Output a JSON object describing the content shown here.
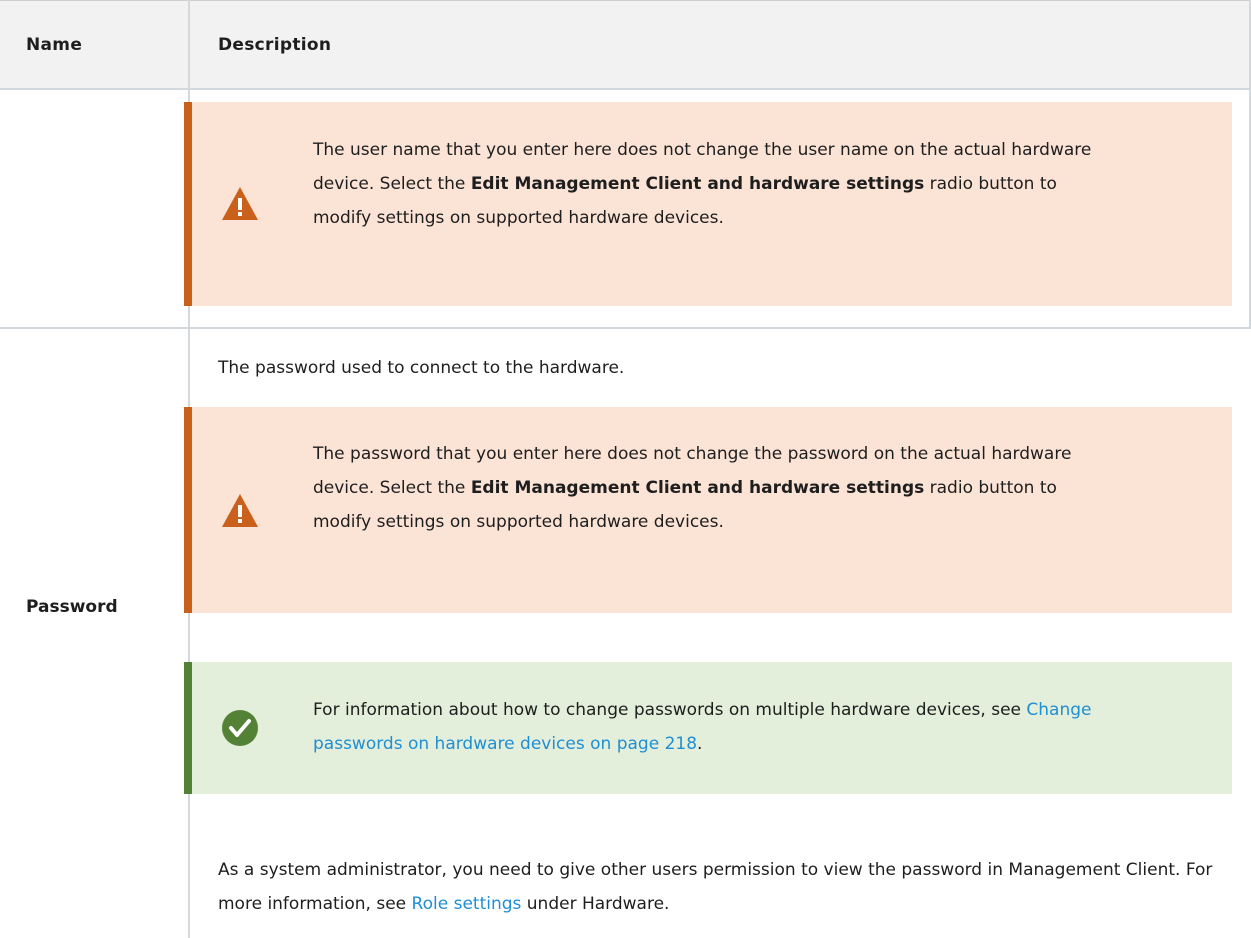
{
  "table": {
    "header": {
      "name": "Name",
      "description": "Description"
    },
    "rows": [
      {
        "name": "",
        "callouts": [
          {
            "kind": "warning",
            "icon": "warning-triangle-icon",
            "text_start": "The user name that you enter here does not change the user name on the actual hardware device. Select the ",
            "bold": "Edit Management Client and hardware settings",
            "text_end": " radio button to modify settings on supported hardware devices."
          }
        ]
      },
      {
        "name": "Password",
        "intro": "The password used to connect to the hardware.",
        "callouts": [
          {
            "kind": "warning",
            "icon": "warning-triangle-icon",
            "text_start": "The password that you enter here does not change the password on the actual hardware device. Select the ",
            "bold": "Edit Management Client and hardware settings",
            "text_end": " radio button to modify settings on supported hardware devices."
          },
          {
            "kind": "tip",
            "icon": "checkmark-circle-icon",
            "text_start": "For information about how to change passwords on multiple hardware devices, see ",
            "link": "Change passwords on hardware devices on page 218",
            "text_end": "."
          }
        ],
        "note_start": "As a system administrator, you need to give other users permission to view the password in Management Client. For more information, see ",
        "note_link": "Role settings",
        "note_end": " under Hardware."
      }
    ]
  },
  "colors": {
    "warning_bg": "#fbe3d6",
    "warning_bar": "#c9601b",
    "tip_bg": "#e3eedb",
    "tip_bar": "#538135",
    "link": "#1f8fd3",
    "grid": "#d3d8dc",
    "header_bg": "#f2f2f2"
  }
}
